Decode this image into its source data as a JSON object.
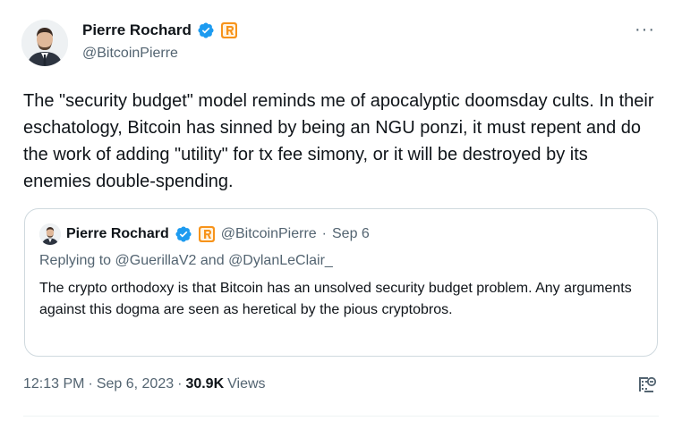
{
  "author": {
    "name": "Pierre Rochard",
    "handle": "@BitcoinPierre"
  },
  "more_label": "···",
  "tweet": {
    "text": "The \"security budget\" model reminds me of apocalyptic doomsday cults. In their eschatology, Bitcoin has sinned by being an NGU ponzi, it must repent and do the work of adding \"utility\" for tx fee simony, or it will be destroyed by its enemies double-spending."
  },
  "quoted": {
    "name": "Pierre Rochard",
    "handle": "@BitcoinPierre",
    "separator": "·",
    "date": "Sep 6",
    "replying_prefix": "Replying to",
    "reply_to_1": "@GuerillaV2",
    "reply_and": "and",
    "reply_to_2": "@DylanLeClair_",
    "text": "The crypto orthodoxy is that Bitcoin has an unsolved security budget problem. Any arguments against this dogma are seen as heretical by the pious cryptobros."
  },
  "footer": {
    "time": "12:13 PM",
    "sep1": "·",
    "date": "Sep 6, 2023",
    "sep2": "·",
    "views_count": "30.9K",
    "views_label": "Views"
  },
  "colors": {
    "verified": "#1d9bf0",
    "affiliate": "#f7931a",
    "secondary_text": "#536471",
    "border": "#cfd9de"
  },
  "icons": {
    "verified": "verified-badge-icon",
    "affiliate": "affiliate-badge-icon",
    "more": "more-dots-icon",
    "bookmark": "bookmark-icon"
  }
}
